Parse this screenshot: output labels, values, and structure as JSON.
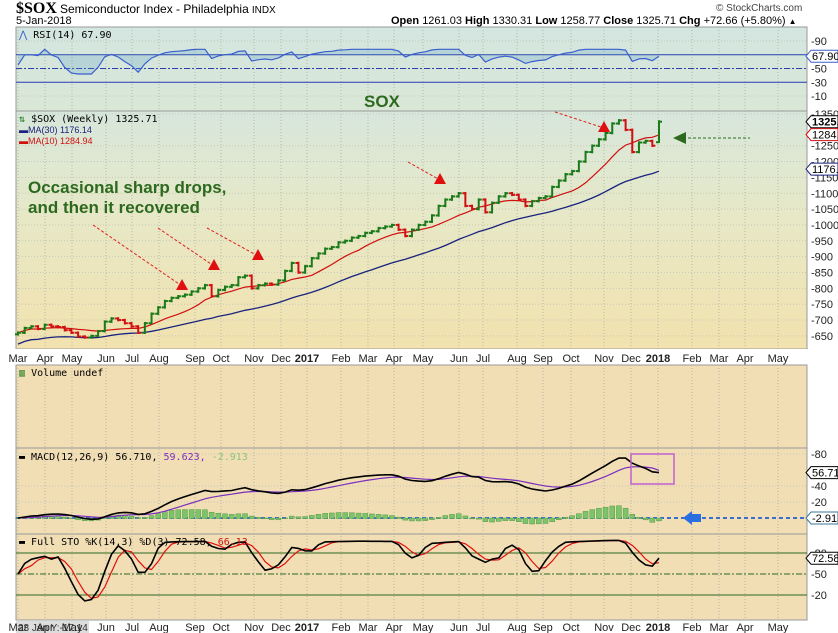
{
  "header": {
    "symbol": "$SOX",
    "name": "Semiconductor Index - Philadelphia",
    "exchange": "INDX",
    "date": "5-Jan-2018",
    "watermark": "© StockCharts.com",
    "open_label": "Open",
    "open": "1261.03",
    "high_label": "High",
    "high": "1330.31",
    "low_label": "Low",
    "low": "1258.77",
    "close_label": "Close",
    "close": "1325.71",
    "chg_label": "Chg",
    "chg": "+72.66 (+5.80%)",
    "up_indicator": "▲"
  },
  "rsi": {
    "label": "RSI(14) 67.90",
    "value_tag": "67.90",
    "ticks": [
      "90",
      "50",
      "30",
      "10"
    ]
  },
  "price": {
    "legend_main": "$SOX (Weekly) 1325.71",
    "legend_ma30": "MA(30) 1176.14",
    "legend_ma10": "MA(10) 1284.94",
    "tag_close": "1325.71",
    "tag_ma10": "1284.94",
    "tag_ma30": "1176.14",
    "title": "SOX",
    "annotation_line1": "Occasional sharp drops,",
    "annotation_line2": "and then it recovered",
    "ticks": [
      "1350",
      "1250",
      "1200",
      "1150",
      "1100",
      "1050",
      "1000",
      "950",
      "900",
      "850",
      "800",
      "750",
      "700",
      "650"
    ]
  },
  "volume": {
    "label": "Volume undef"
  },
  "macd": {
    "label_name": "MACD(12,26,9) 56.710,",
    "signal": "59.623,",
    "hist": "-2.913",
    "tag_macd": "56.710",
    "tag_hist": "-2.913",
    "ticks": [
      "80",
      "40",
      "20"
    ]
  },
  "sto": {
    "label_name": "Full STO %K(14,3) %D(3) 72.58,",
    "d": "66.13",
    "tag_k": "72.58",
    "ticks": [
      "80",
      "50",
      "20"
    ]
  },
  "months": [
    "Mar",
    "Apr",
    "May",
    "Jun",
    "Jul",
    "Aug",
    "Sep",
    "Oct",
    "Nov",
    "Dec",
    "2017",
    "Feb",
    "Mar",
    "Apr",
    "May",
    "Jun",
    "Jul",
    "Aug",
    "Sep",
    "Oct",
    "Nov",
    "Dec",
    "2018",
    "Feb",
    "Mar",
    "Apr",
    "May"
  ],
  "cursor_readout": "23 Jan Y:-17.14",
  "colors": {
    "up": "#1a7a1a",
    "down": "#d01010",
    "ma30": "#1a237e",
    "ma10": "#d01010",
    "rsi": "#3a5fcd",
    "signal": "#7b2fbe",
    "hist": "#7cc46a",
    "accent": "#2d6a1f"
  },
  "chart_data": {
    "type": "ohlc",
    "title": "$SOX Semiconductor Index - Philadelphia (Weekly)",
    "x_start": "Mar 2016",
    "x_end": "5-Jan-2018",
    "ylim": [
      620,
      1360
    ],
    "weekly_close": [
      660,
      675,
      680,
      672,
      685,
      680,
      678,
      668,
      660,
      648,
      645,
      650,
      665,
      695,
      705,
      700,
      690,
      680,
      660,
      690,
      720,
      740,
      760,
      770,
      775,
      780,
      790,
      800,
      810,
      775,
      795,
      805,
      810,
      835,
      840,
      800,
      810,
      815,
      812,
      825,
      855,
      880,
      850,
      870,
      895,
      910,
      925,
      930,
      945,
      950,
      960,
      965,
      975,
      980,
      990,
      995,
      1000,
      985,
      965,
      985,
      1000,
      1010,
      1030,
      1060,
      1080,
      1090,
      1100,
      1060,
      1050,
      1080,
      1040,
      1070,
      1090,
      1100,
      1095,
      1080,
      1060,
      1075,
      1085,
      1090,
      1120,
      1140,
      1160,
      1170,
      1200,
      1230,
      1250,
      1270,
      1290,
      1320,
      1330,
      1300,
      1230,
      1260,
      1265,
      1250,
      1325.71
    ],
    "last_bar": {
      "open": 1261.03,
      "high": 1330.31,
      "low": 1258.77,
      "close": 1325.71
    },
    "ma30_last": 1176.14,
    "ma10_last": 1284.94,
    "rsi_last": 67.9,
    "macd_last": 56.71,
    "signal_last": 59.623,
    "hist_last": -2.913,
    "sto_k_last": 72.58,
    "sto_d_last": 66.13
  }
}
